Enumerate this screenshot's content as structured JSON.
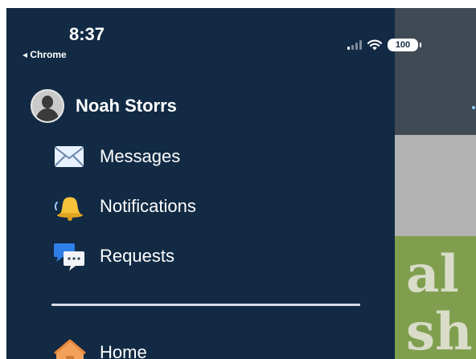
{
  "status_bar": {
    "time": "8:37",
    "back_label": "◂ Chrome",
    "battery": "100"
  },
  "profile": {
    "name": "Noah Storrs"
  },
  "menu": {
    "items": [
      {
        "label": "Messages",
        "icon": "envelope-icon"
      },
      {
        "label": "Notifications",
        "icon": "bell-icon"
      },
      {
        "label": "Requests",
        "icon": "chat-bubbles-icon"
      }
    ],
    "home": {
      "label": "Home",
      "icon": "house-icon"
    }
  },
  "background": {
    "line1": "al",
    "line2": "sh"
  },
  "colors": {
    "drawer": "#122a44",
    "text": "#ffffff",
    "bell": "#f6c23a",
    "envelope": "#e8f1ff",
    "chat_blue": "#2e7fe8",
    "home_orange": "#f2a25a"
  }
}
